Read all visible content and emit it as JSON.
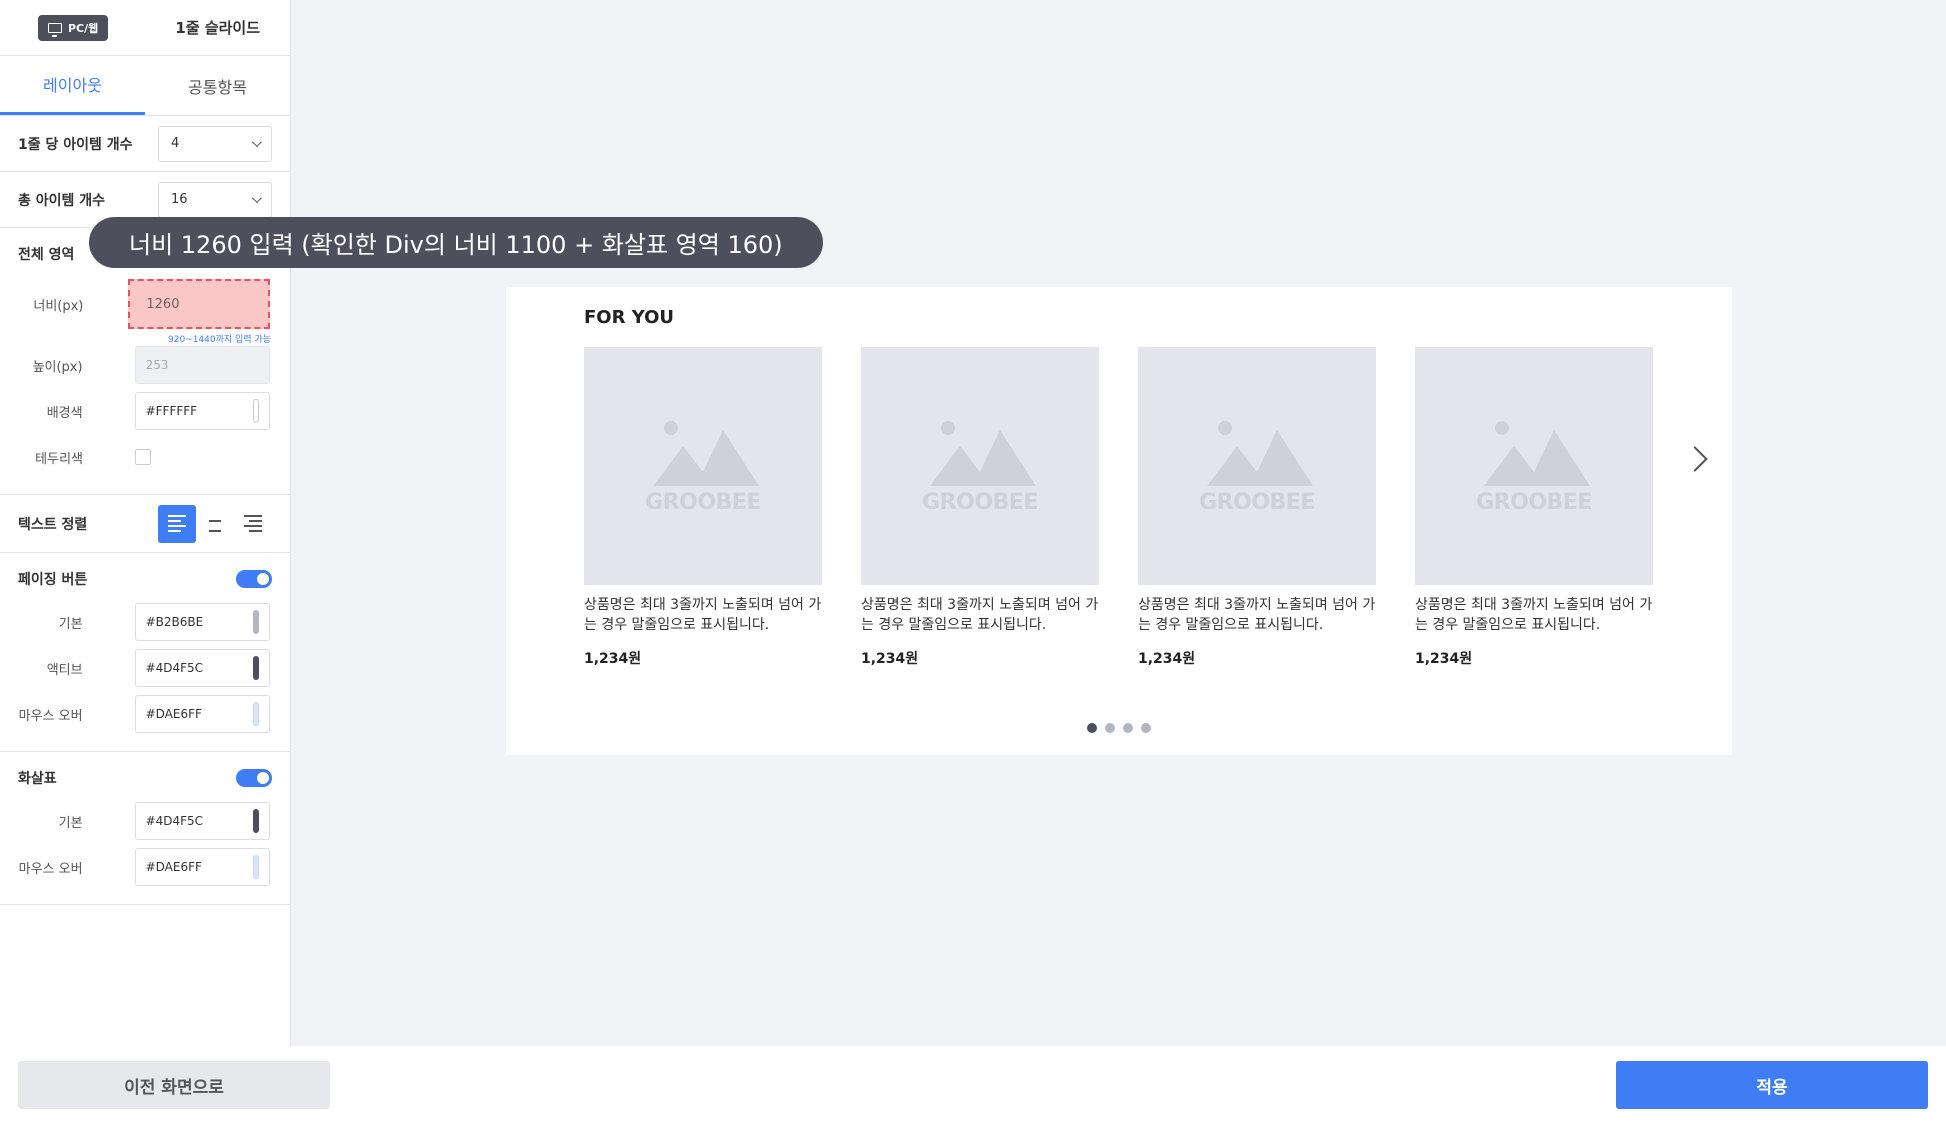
{
  "sidebar": {
    "device_badge": "PC/웹",
    "title": "1줄 슬라이드",
    "tabs": [
      {
        "label": "레이아웃",
        "active": true
      },
      {
        "label": "공통항목",
        "active": false
      }
    ],
    "items_per_row": {
      "label": "1줄 당 아이템 개수",
      "value": "4"
    },
    "total_items": {
      "label": "총 아이템 개수",
      "value": "16"
    },
    "area": {
      "title": "전체 영역",
      "width_label": "너비(px)",
      "width_value": "1260",
      "width_hint": "920~1440까지 입력 가능",
      "height_label": "높이(px)",
      "height_value": "253",
      "bg_label": "배경색",
      "bg_value": "#FFFFFF",
      "border_label": "테두리색"
    },
    "text_align": {
      "label": "텍스트 정렬",
      "selected": "left"
    },
    "paging": {
      "title": "페이징 버튼",
      "enabled": true,
      "default_label": "기본",
      "default_value": "#B2B6BE",
      "active_label": "액티브",
      "active_value": "#4D4F5C",
      "hover_label": "마우스 오버",
      "hover_value": "#DAE6FF"
    },
    "arrow": {
      "title": "화살표",
      "enabled": true,
      "default_label": "기본",
      "default_value": "#4D4F5C",
      "hover_label": "마우스 오버",
      "hover_value": "#DAE6FF"
    }
  },
  "tooltip": "너비 1260 입력 (확인한 Div의 너비 1100 + 화살표 영역 160)",
  "preview": {
    "title": "FOR YOU",
    "products": [
      {
        "brand": "GROOBEE",
        "name": "상품명은 최대 3줄까지 노출되며 넘어 가는 경우 말줄임으로 표시됩니다.",
        "price": "1,234원"
      },
      {
        "brand": "GROOBEE",
        "name": "상품명은 최대 3줄까지 노출되며 넘어 가는 경우 말줄임으로 표시됩니다.",
        "price": "1,234원"
      },
      {
        "brand": "GROOBEE",
        "name": "상품명은 최대 3줄까지 노출되며 넘어 가는 경우 말줄임으로 표시됩니다.",
        "price": "1,234원"
      },
      {
        "brand": "GROOBEE",
        "name": "상품명은 최대 3줄까지 노출되며 넘어 가는 경우 말줄임으로 표시됩니다.",
        "price": "1,234원"
      }
    ],
    "page_count": 4,
    "active_page": 1
  },
  "footer": {
    "prev_label": "이전 화면으로",
    "apply_label": "적용"
  },
  "colors": {
    "accent": "#3F7DF5",
    "dark": "#4D4F5C",
    "highlight_fill": "#FBC6C6",
    "highlight_border": "#F0505A"
  }
}
